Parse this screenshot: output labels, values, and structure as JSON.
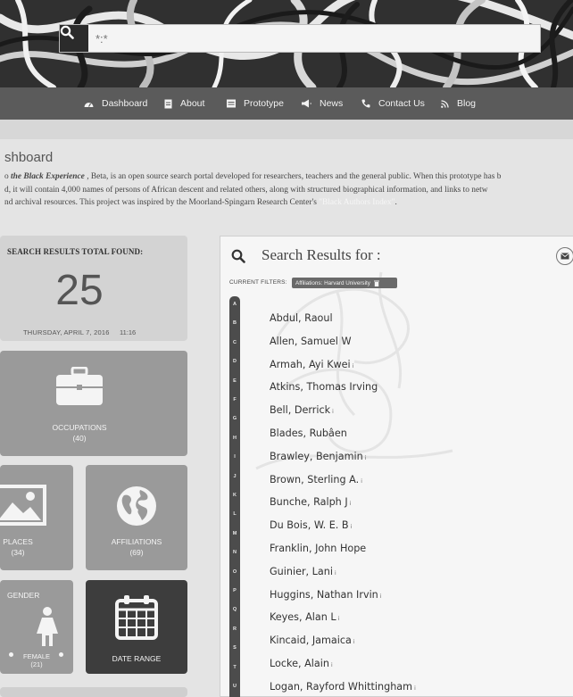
{
  "search": {
    "placeholder": "*:*"
  },
  "nav": {
    "items": [
      {
        "label": "Dashboard",
        "icon": "dashboard-icon"
      },
      {
        "label": "About",
        "icon": "document-icon"
      },
      {
        "label": "Prototype",
        "icon": "list-icon"
      },
      {
        "label": "News",
        "icon": "megaphone-icon"
      },
      {
        "label": "Contact Us",
        "icon": "phone-icon"
      },
      {
        "label": "Blog",
        "icon": "rss-icon"
      }
    ]
  },
  "intro": {
    "title": "shboard",
    "line1_pre": "o ",
    "line1_emph": "the Black Experience",
    "line1_post": " , Beta, is an open source search portal developed for researchers, teachers and the general public. When this prototype has b",
    "line2": "d, it will contain 4,000 names of persons of African descent and related others, along with structured biographical information, and links to netw",
    "line3_pre": "nd archival resources. This project was inspired by the Moorland-Spingarn Research Center's ",
    "line3_link": "\"Black Authors Index\"",
    "line3_post": "."
  },
  "stats": {
    "total_label": "SEARCH RESULTS TOTAL FOUND:",
    "total_count": "25",
    "date": "THURSDAY, APRIL 7, 2016",
    "time": "11:16"
  },
  "tiles": {
    "occupations": {
      "label": "OCCUPATIONS",
      "count": "(40)"
    },
    "places": {
      "label": "PLACES",
      "count": "(34)"
    },
    "affiliations": {
      "label": "AFFILIATIONS",
      "count": "(69)"
    },
    "gender": {
      "label": "GENDER",
      "female_label": "FEMALE",
      "female_count": "(21)"
    },
    "date_range": {
      "label": "DATE RANGE"
    }
  },
  "results_panel": {
    "title": "Search Results for :",
    "filters_label": "CURRENT FILTERS:",
    "filter_chip": "Affiliations: Harvard University",
    "alphabet": [
      "A",
      "B",
      "C",
      "D",
      "E",
      "F",
      "G",
      "H",
      "I",
      "J",
      "K",
      "L",
      "M",
      "N",
      "O",
      "P",
      "Q",
      "R",
      "S",
      "T",
      "U"
    ],
    "results": [
      {
        "name": "Abdul, Raoul",
        "info": false
      },
      {
        "name": "Allen, Samuel W",
        "info": false
      },
      {
        "name": "Armah, Ayi Kwei",
        "info": true
      },
      {
        "name": "Atkins, Thomas Irving",
        "info": false
      },
      {
        "name": "Bell, Derrick",
        "info": true
      },
      {
        "name": "Blades, Rubâen",
        "info": false
      },
      {
        "name": "Brawley, Benjamin",
        "info": true
      },
      {
        "name": "Brown, Sterling A.",
        "info": true
      },
      {
        "name": "Bunche, Ralph J",
        "info": true
      },
      {
        "name": "Du Bois, W. E. B",
        "info": true
      },
      {
        "name": "Franklin, John Hope",
        "info": false
      },
      {
        "name": "Guinier, Lani",
        "info": true
      },
      {
        "name": "Huggins, Nathan Irvin",
        "info": true
      },
      {
        "name": "Keyes, Alan L",
        "info": true
      },
      {
        "name": "Kincaid, Jamaica",
        "info": true
      },
      {
        "name": "Locke, Alain",
        "info": true
      },
      {
        "name": "Logan, Rayford Whittingham",
        "info": true
      }
    ],
    "info_glyph": "i"
  }
}
